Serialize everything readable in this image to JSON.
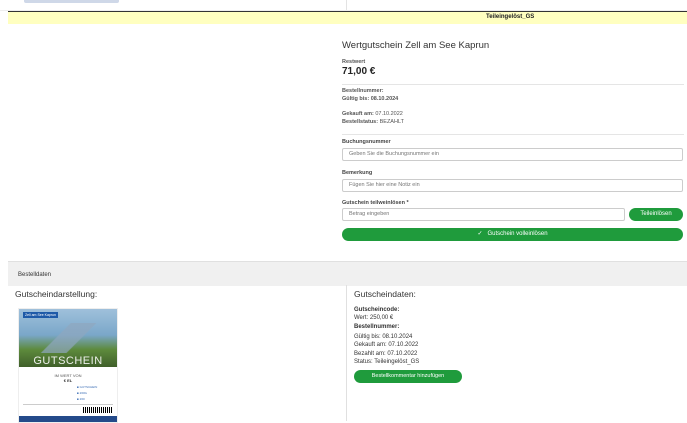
{
  "banner": {
    "status": "Teileingelöst_GS"
  },
  "product": {
    "title": "Wertgutschein Zell am See Kaprun",
    "restwert_label": "Restwert",
    "price": "71,00 €",
    "bestellnummer_label": "Bestellnummer:",
    "gueltig": "Gültig bis: 08.10.2024",
    "gekauft_label": "Gekauft am:",
    "gekauft_value": "07.10.2022",
    "bestellstatus_label": "Bestellstatus:",
    "bestellstatus_value": "BEZAHLT"
  },
  "form": {
    "buchung_label": "Buchungsnummer",
    "buchung_placeholder": "Geben Sie die Buchungsnummer ein",
    "bemerkung_label": "Bemerkung",
    "bemerkung_placeholder": "Fügen Sie hier eine Notiz ein",
    "teilweise_label": "Gutschein teilweinlösen *",
    "betrag_placeholder": "Betrag eingeben",
    "teileinloesen_button": "Teileinlösen",
    "volleinloesen_button": "Gutschein volleinlösen",
    "check_icon": "✓"
  },
  "section": {
    "title": "Bestelldaten"
  },
  "left_column": {
    "heading": "Gutscheindarstellung:",
    "voucher": {
      "logo": "Zell am See Kaprun",
      "big_text": "GUTSCHEIN",
      "wert_label": "IM WERT VON",
      "currency": "€ EL",
      "lines": [
        "■ GUTSCHEIN",
        "■ 260G",
        "■ 260"
      ]
    }
  },
  "right_column": {
    "heading": "Gutscheindaten:",
    "code_label": "Gutscheincode:",
    "wert": "Wert: 250,00 €",
    "bestellnummer": "Bestellnummer:",
    "gueltig": "Gültig bis: 08.10.2024",
    "gekauft": "Gekauft am: 07.10.2022",
    "bezahlt": "Bezahlt am: 07.10.2022",
    "status": "Status: Teileingelöst_GS",
    "button": "Bestellkommentar hinzufügen"
  }
}
